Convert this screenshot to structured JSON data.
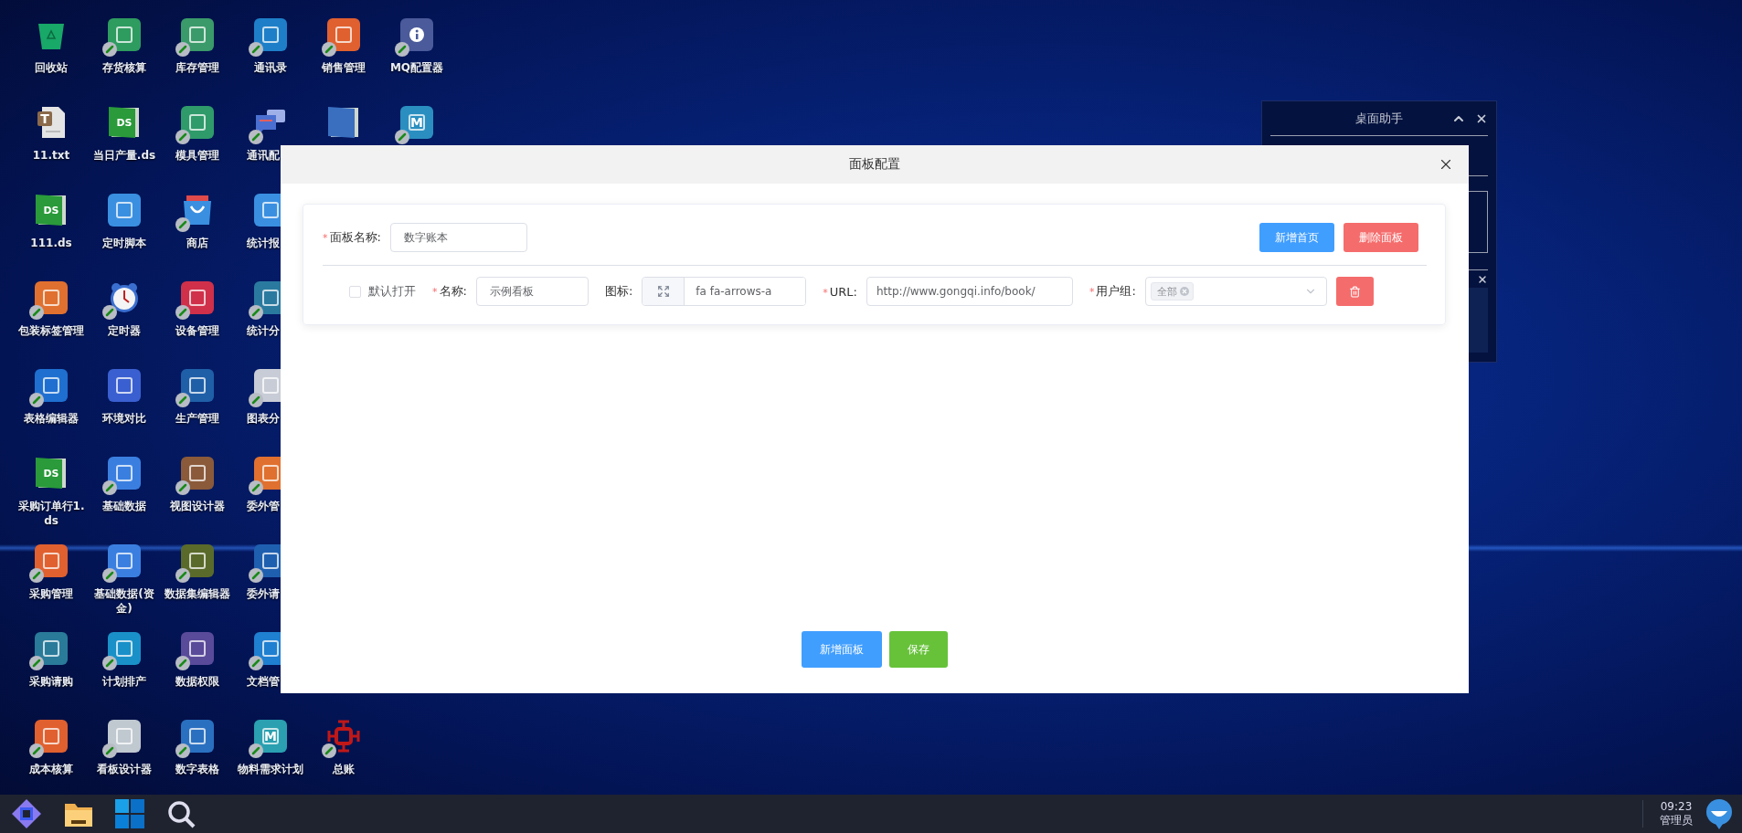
{
  "desktop": {
    "rows": [
      [
        {
          "label": "回收站",
          "kind": "bin",
          "color": "#18a868",
          "shortcut": false
        },
        {
          "label": "存货核算",
          "kind": "tile",
          "color": "#2e9b5f",
          "shortcut": true
        },
        {
          "label": "库存管理",
          "kind": "tile",
          "color": "#3a9a6a",
          "shortcut": true
        },
        {
          "label": "通讯录",
          "kind": "tile",
          "color": "#1e7fc8",
          "shortcut": true
        },
        {
          "label": "销售管理",
          "kind": "tile",
          "color": "#e0602f",
          "shortcut": true
        },
        {
          "label": "MQ配置器",
          "kind": "info",
          "color": "#4a5a9a",
          "shortcut": true
        }
      ],
      [
        {
          "label": "11.txt",
          "kind": "file",
          "glyph": "T",
          "color": "#8a6a4a",
          "shortcut": false
        },
        {
          "label": "当日产量.ds",
          "kind": "book",
          "glyph": "DS",
          "color": "#2a9a3a",
          "shortcut": false
        },
        {
          "label": "模具管理",
          "kind": "tile",
          "color": "#2f9a6a",
          "shortcut": true
        },
        {
          "label": "通讯配",
          "kind": "chat",
          "color": "#4a6fd0",
          "shortcut": true,
          "cut": true
        },
        {
          "kind": "book",
          "color": "#3a6fc0",
          "shortcut": false
        },
        {
          "kind": "tile",
          "glyph": "M",
          "color": "#2a8fc0",
          "shortcut": true
        }
      ],
      [
        {
          "label": "111.ds",
          "kind": "book",
          "glyph": "DS",
          "color": "#2a9a3a",
          "shortcut": false
        },
        {
          "label": "定时脚本",
          "kind": "tile",
          "color": "#3a8fe0",
          "shortcut": false
        },
        {
          "label": "商店",
          "kind": "bag",
          "color": "#3a8fe0",
          "shortcut": true
        },
        {
          "label": "统计报",
          "kind": "tile",
          "color": "#3a8fe0",
          "shortcut": false,
          "cut": true
        }
      ],
      [
        {
          "label": "包装标签管理",
          "kind": "tile",
          "color": "#e0702f",
          "shortcut": true
        },
        {
          "label": "定时器",
          "kind": "clock",
          "color": "#3a6fd0",
          "shortcut": true
        },
        {
          "label": "设备管理",
          "kind": "tile",
          "color": "#d0304a",
          "shortcut": true
        },
        {
          "label": "统计分",
          "kind": "tile",
          "color": "#2a7aa0",
          "shortcut": true,
          "cut": true
        }
      ],
      [
        {
          "label": "表格编辑器",
          "kind": "tile",
          "color": "#1f6fd0",
          "shortcut": true
        },
        {
          "label": "环境对比",
          "kind": "tile",
          "color": "#3a5fd0",
          "shortcut": false
        },
        {
          "label": "生产管理",
          "kind": "tile",
          "color": "#1f5fa8",
          "shortcut": true
        },
        {
          "label": "图表分",
          "kind": "tile",
          "color": "#c8ccd6",
          "shortcut": true,
          "cut": true
        }
      ],
      [
        {
          "label": "采购订单行1.ds",
          "kind": "book",
          "glyph": "DS",
          "color": "#2a9a3a",
          "shortcut": false
        },
        {
          "label": "基础数据",
          "kind": "tile",
          "color": "#3a7fe0",
          "shortcut": true
        },
        {
          "label": "视图设计器",
          "kind": "tile",
          "color": "#8a5a3a",
          "shortcut": true
        },
        {
          "label": "委外管",
          "kind": "tile",
          "color": "#e0702f",
          "shortcut": true,
          "cut": true
        }
      ],
      [
        {
          "label": "采购管理",
          "kind": "tile",
          "color": "#e0602f",
          "shortcut": true
        },
        {
          "label": "基础数据(资金)",
          "kind": "tile",
          "color": "#3a7fe0",
          "shortcut": true
        },
        {
          "label": "数据集编辑器",
          "kind": "tile",
          "color": "#5a6a2a",
          "shortcut": true
        },
        {
          "label": "委外请",
          "kind": "tile",
          "color": "#1f5fb0",
          "shortcut": true,
          "cut": true
        }
      ],
      [
        {
          "label": "采购请购",
          "kind": "tile",
          "color": "#2a7a9a",
          "shortcut": true
        },
        {
          "label": "计划排产",
          "kind": "tile",
          "color": "#1a90c8",
          "shortcut": true
        },
        {
          "label": "数据权限",
          "kind": "tile",
          "color": "#5a4a9a",
          "shortcut": true
        },
        {
          "label": "文档管",
          "kind": "tile",
          "color": "#1f7fd0",
          "shortcut": true,
          "cut": true
        }
      ],
      [
        {
          "label": "成本核算",
          "kind": "tile",
          "color": "#e0602f",
          "shortcut": true
        },
        {
          "label": "看板设计器",
          "kind": "tile",
          "color": "#c0c8d0",
          "shortcut": true
        },
        {
          "label": "数字表格",
          "kind": "tile",
          "color": "#2a70c0",
          "shortcut": true
        },
        {
          "label": "物料需求计划",
          "kind": "tile",
          "glyph": "M",
          "color": "#2aa0b0",
          "shortcut": true
        },
        {
          "label": "总账",
          "kind": "cross",
          "color": "#c01818",
          "shortcut": true
        }
      ]
    ]
  },
  "assistant_panel": {
    "title": "桌面助手"
  },
  "dialog": {
    "title": "面板配置",
    "panel_name": {
      "mark": "*",
      "label": "面板名称:",
      "value": "数字账本"
    },
    "actions": [
      {
        "label": "新增首页",
        "kind": "primary"
      },
      {
        "label": "删除面板",
        "kind": "danger"
      }
    ],
    "entries": [
      {
        "default_open": {
          "label": "默认打开",
          "checked": false
        },
        "name": {
          "mark": "*",
          "label": "名称:",
          "value": "示例看板"
        },
        "icon": {
          "label": "图标:",
          "value": "fa fa-arrows-a"
        },
        "url": {
          "mark": "*",
          "label": "URL:",
          "value": "http://www.gongqi.info/book/"
        },
        "user_group": {
          "mark": "*",
          "label": "用户组:",
          "tags": [
            "全部"
          ]
        }
      }
    ],
    "footer_buttons": [
      {
        "label": "新增面板",
        "kind": "primary"
      },
      {
        "label": "保存",
        "kind": "success"
      }
    ]
  },
  "taskbar": {
    "time": "09:23",
    "user": "管理员"
  }
}
